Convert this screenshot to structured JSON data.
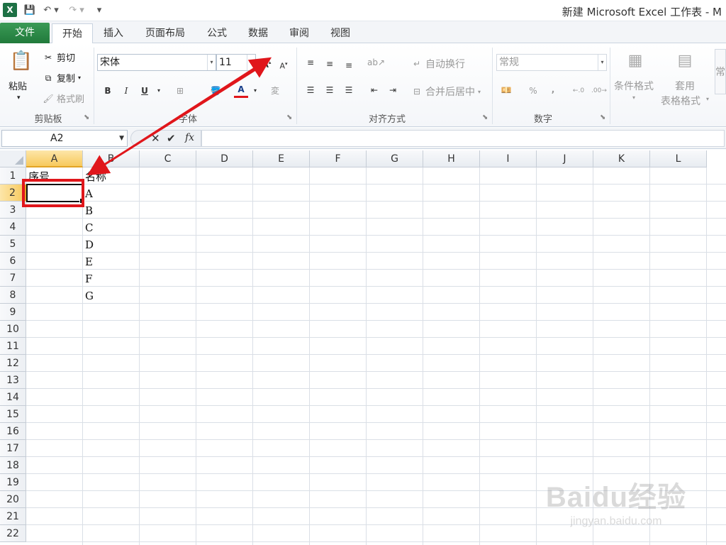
{
  "window": {
    "title": "新建 Microsoft Excel 工作表 - M",
    "app_logo": "X"
  },
  "tabs": [
    {
      "label": "文件"
    },
    {
      "label": "开始"
    },
    {
      "label": "插入"
    },
    {
      "label": "页面布局"
    },
    {
      "label": "公式"
    },
    {
      "label": "数据"
    },
    {
      "label": "审阅"
    },
    {
      "label": "视图"
    }
  ],
  "ribbon": {
    "clipboard": {
      "paste": "粘贴",
      "cut": "剪切",
      "copy": "复制",
      "format_painter": "格式刷",
      "group": "剪贴板"
    },
    "font": {
      "name": "宋体",
      "size": "11",
      "bold": "B",
      "italic": "I",
      "underline": "U",
      "color_a": "A",
      "group": "字体"
    },
    "alignment": {
      "wrap": "自动换行",
      "merge": "合并后居中",
      "group": "对齐方式"
    },
    "number": {
      "format": "常规",
      "percent": "%",
      "comma": ",",
      "group": "数字"
    },
    "styles": {
      "conditional": "条件格式",
      "table1": "套用",
      "table2": "表格格式",
      "cell_styles": "常"
    }
  },
  "formula_bar": {
    "name_box": "A2",
    "cancel": "✕",
    "enter": "✔",
    "fx": "fx",
    "value": ""
  },
  "columns": [
    "A",
    "B",
    "C",
    "D",
    "E",
    "F",
    "G",
    "H",
    "I",
    "J",
    "K",
    "L"
  ],
  "rows": [
    "1",
    "2",
    "3",
    "4",
    "5",
    "6",
    "7",
    "8",
    "9",
    "10",
    "11",
    "12",
    "13",
    "14",
    "15",
    "16",
    "17",
    "18",
    "19",
    "20",
    "21",
    "22"
  ],
  "cells": {
    "A1": "序号",
    "B1": "名称",
    "B2": "A",
    "B3": "B",
    "B4": "C",
    "B5": "D",
    "B6": "E",
    "B7": "F",
    "B8": "G"
  },
  "selection": {
    "active": "A2",
    "active_col": "A",
    "active_row": "2"
  },
  "watermark": {
    "brand": "Baidu经验",
    "url": "jingyan.baidu.com"
  },
  "colors": {
    "file_tab": "#217a3b",
    "annotation": "#e0161b",
    "header_selected": "#f7c95c"
  }
}
